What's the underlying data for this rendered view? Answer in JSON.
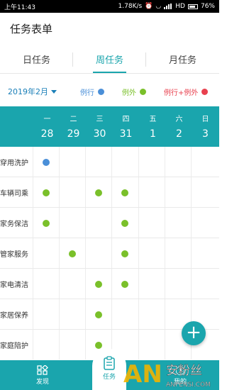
{
  "status_bar": {
    "time": "上午11:43",
    "speed": "1.78K/s",
    "network": "HD",
    "battery": "76%"
  },
  "app": {
    "title": "任务表单"
  },
  "tabs": [
    {
      "label": "日任务",
      "active": false
    },
    {
      "label": "周任务",
      "active": true
    },
    {
      "label": "月任务",
      "active": false
    }
  ],
  "filter": {
    "month": "2019年2月",
    "legend": [
      {
        "label": "例行",
        "color": "#4a8fd8",
        "text_color": "#4a8fd8"
      },
      {
        "label": "例外",
        "color": "#7ac02a",
        "text_color": "#7ac02a"
      },
      {
        "label": "例行+例外",
        "color": "#e8404e",
        "text_color": "#e8404e"
      }
    ]
  },
  "calendar": {
    "weekdays": [
      "一",
      "二",
      "三",
      "四",
      "五",
      "六",
      "日"
    ],
    "days": [
      "28",
      "29",
      "30",
      "31",
      "1",
      "2",
      "3"
    ]
  },
  "tasks": [
    {
      "label": "穿用洗护",
      "marks": [
        "routine",
        null,
        null,
        null,
        null,
        null,
        null
      ]
    },
    {
      "label": "车辆司乘",
      "marks": [
        "exception",
        null,
        "exception",
        "exception",
        null,
        null,
        null
      ]
    },
    {
      "label": "家务保洁",
      "marks": [
        "exception",
        null,
        null,
        "exception",
        null,
        null,
        null
      ]
    },
    {
      "label": "管家服务",
      "marks": [
        null,
        "exception",
        null,
        "exception",
        null,
        null,
        null
      ]
    },
    {
      "label": "家电清洁",
      "marks": [
        null,
        null,
        "exception",
        "exception",
        null,
        null,
        null
      ]
    },
    {
      "label": "家居保养",
      "marks": [
        null,
        null,
        "exception",
        null,
        null,
        null,
        null
      ]
    },
    {
      "label": "家庭陪护",
      "marks": [
        null,
        null,
        "exception",
        null,
        null,
        null,
        null
      ]
    }
  ],
  "mark_colors": {
    "routine": "#4a8fd8",
    "exception": "#7ac02a",
    "both": "#e8404e"
  },
  "fab": {
    "label": "+"
  },
  "bottom_nav": {
    "discover": "发现",
    "task": "任务",
    "mine": "我的"
  },
  "watermark": {
    "text1": "安粉丝",
    "text2": "ANFENSI.COM"
  }
}
